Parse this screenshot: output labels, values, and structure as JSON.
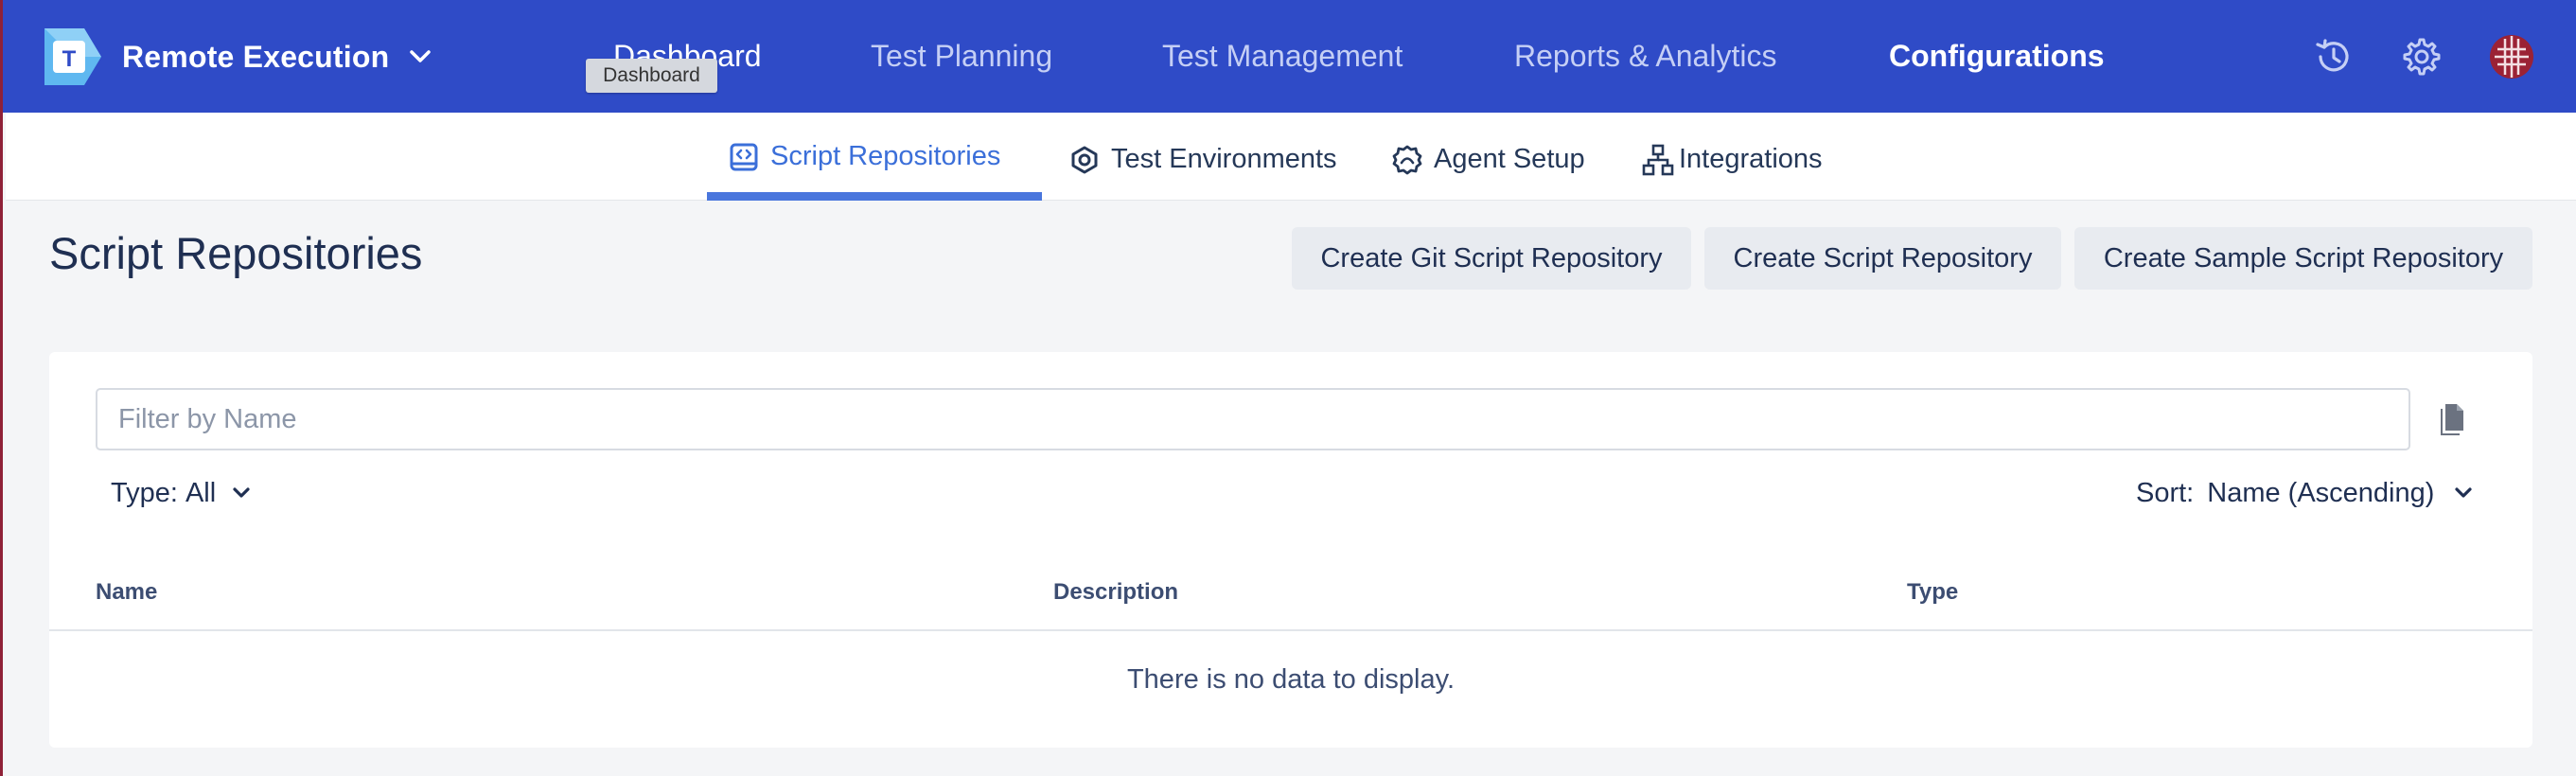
{
  "app": {
    "name": "Remote Execution",
    "logo_letter": "T",
    "accent_color": "#2f4bc7"
  },
  "topnav": {
    "items": [
      {
        "label": "Dashboard"
      },
      {
        "label": "Test Planning"
      },
      {
        "label": "Test Management"
      },
      {
        "label": "Reports & Analytics"
      },
      {
        "label": "Configurations"
      }
    ],
    "active": "Configurations",
    "tooltip": "Dashboard",
    "icons": [
      "history-icon",
      "settings-gear-icon",
      "user-avatar-icon"
    ]
  },
  "subnav": {
    "tabs": [
      {
        "label": "Script Repositories",
        "icon": "code-file-icon"
      },
      {
        "label": "Test Environments",
        "icon": "hexagon-icon"
      },
      {
        "label": "Agent Setup",
        "icon": "gear-badge-icon"
      },
      {
        "label": "Integrations",
        "icon": "sitemap-icon"
      }
    ],
    "active": "Script Repositories"
  },
  "page": {
    "title": "Script Repositories",
    "actions": [
      {
        "label": "Create Git Script Repository"
      },
      {
        "label": "Create Script Repository"
      },
      {
        "label": "Create Sample Script Repository"
      }
    ]
  },
  "filters": {
    "search_placeholder": "Filter by Name",
    "search_value": "",
    "type_label": "Type:",
    "type_value": "All",
    "sort_label": "Sort:",
    "sort_value": "Name (Ascending)"
  },
  "table": {
    "columns": [
      "Name",
      "Description",
      "Type"
    ],
    "rows": [],
    "empty_message": "There is no data to display."
  }
}
